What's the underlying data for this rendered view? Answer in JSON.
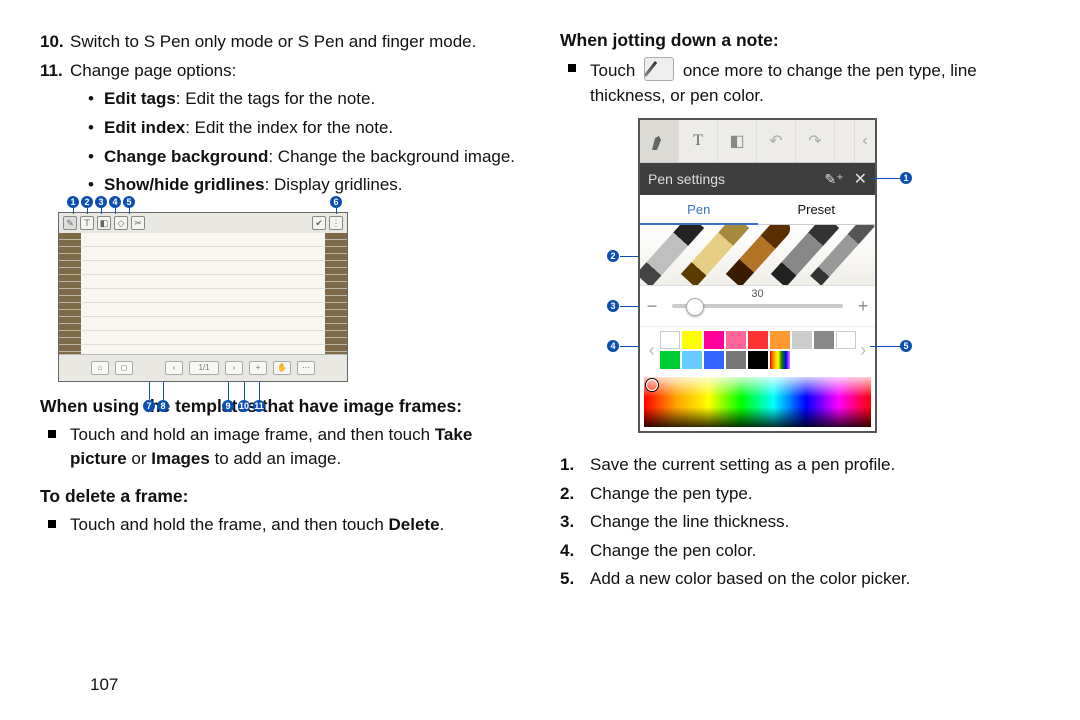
{
  "page_number": "107",
  "left": {
    "items": [
      {
        "num": "10.",
        "text": "Switch to S Pen only mode or S Pen and finger mode."
      },
      {
        "num": "11.",
        "text": "Change page options:",
        "sub": [
          {
            "b": "Edit tags",
            "t": ": Edit the tags for the note."
          },
          {
            "b": "Edit index",
            "t": ": Edit the index for the note."
          },
          {
            "b": "Change background",
            "t": ": Change the background image."
          },
          {
            "b": "Show/hide gridlines",
            "t": ": Display gridlines."
          }
        ]
      }
    ],
    "sec1_h": "When using the templates that have image frames:",
    "sec1_body_a": "Touch and hold an image frame, and then touch ",
    "sec1_body_b": "Take picture",
    "sec1_body_c": " or ",
    "sec1_body_d": "Images",
    "sec1_body_e": " to add an image.",
    "sec2_h": "To delete a frame:",
    "sec2_body_a": "Touch and hold the frame, and then touch ",
    "sec2_body_b": "Delete",
    "sec2_body_c": ".",
    "toolbar_page": "1/1"
  },
  "right": {
    "sec_h": "When jotting down a note:",
    "body_a": "Touch ",
    "body_b": " once more to change the pen type, line thickness, or pen color.",
    "pensettings": {
      "title": "Pen settings",
      "tab_pen": "Pen",
      "tab_preset": "Preset",
      "thickness": "30"
    },
    "list": [
      {
        "n": "1.",
        "t": "Save the current setting as a pen profile."
      },
      {
        "n": "2.",
        "t": "Change the pen type."
      },
      {
        "n": "3.",
        "t": "Change the line thickness."
      },
      {
        "n": "4.",
        "t": "Change the pen color."
      },
      {
        "n": "5.",
        "t": "Add a new color based on the color picker."
      }
    ],
    "palette_row1": [
      "#ffffff",
      "#ffff00",
      "#ff0099",
      "#ff6699",
      "#ff3333",
      "#ff9933",
      "#cccccc",
      "#888888",
      "#ffffff"
    ],
    "palette_row2": [
      "#00cc33",
      "#66ccff",
      "#3366ff",
      "#777777",
      "#000000",
      "rainbow",
      "",
      "",
      ""
    ]
  }
}
